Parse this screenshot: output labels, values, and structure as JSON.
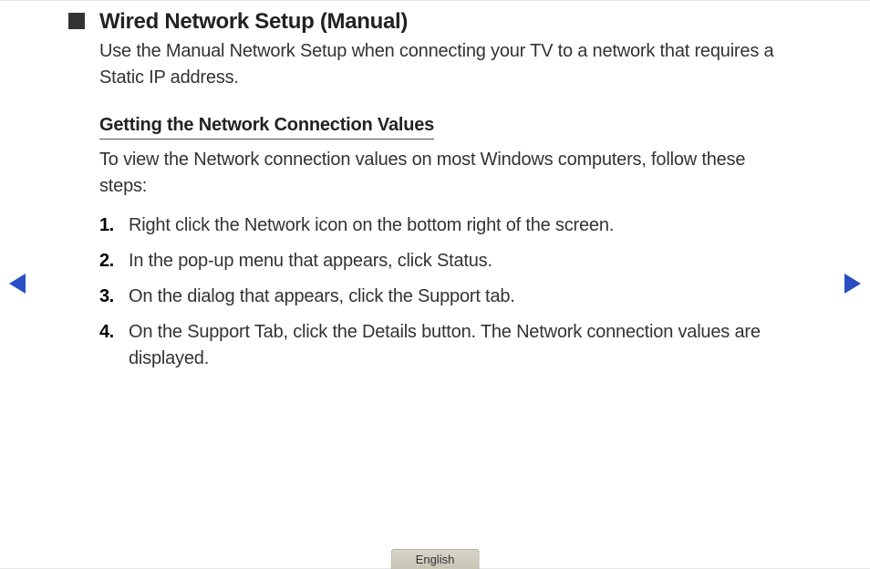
{
  "title": "Wired Network Setup (Manual)",
  "intro": "Use the Manual Network Setup when connecting your TV to a network that requires a Static IP address.",
  "subheading": "Getting the Network Connection Values",
  "subintro": "To view the Network connection values on most Windows computers, follow these steps:",
  "steps": [
    {
      "num": "1.",
      "text": "Right click the Network icon on the bottom right of the screen."
    },
    {
      "num": "2.",
      "text": "In the pop-up menu that appears, click Status."
    },
    {
      "num": "3.",
      "text": "On the dialog that appears, click the Support tab."
    },
    {
      "num": "4.",
      "text": "On the Support Tab, click the Details button. The Network connection values are displayed."
    }
  ],
  "footer": {
    "language": "English"
  }
}
